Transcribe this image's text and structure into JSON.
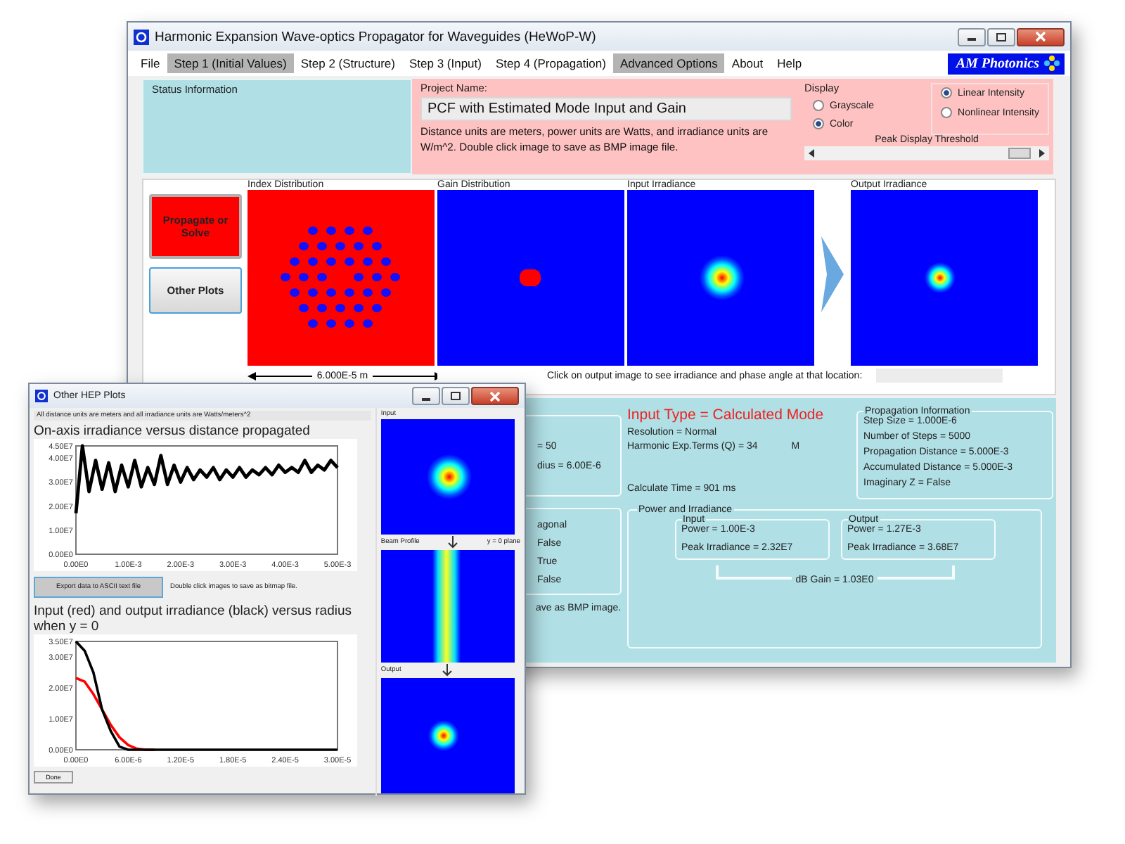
{
  "main_window": {
    "title": "Harmonic Expansion Wave-optics Propagator for Waveguides (HeWoP-W)",
    "menu": [
      {
        "label": "File",
        "highlighted": false
      },
      {
        "label": "Step 1 (Initial Values)",
        "highlighted": true
      },
      {
        "label": "Step 2 (Structure)",
        "highlighted": false
      },
      {
        "label": "Step 3 (Input)",
        "highlighted": false
      },
      {
        "label": "Step 4 (Propagation)",
        "highlighted": false
      },
      {
        "label": "Advanced Options",
        "highlighted": true
      },
      {
        "label": "About",
        "highlighted": false
      },
      {
        "label": "Help",
        "highlighted": false
      }
    ],
    "logo": "AM Photonics",
    "status_panel": {
      "title": "Status Information"
    },
    "project": {
      "label": "Project Name:",
      "value": "PCF with Estimated Mode Input and Gain",
      "note": "Distance units are meters, power units are Watts, and irradiance units are W/m^2.  Double click image to save as BMP image file."
    },
    "display": {
      "title": "Display",
      "color_modes": [
        {
          "label": "Grayscale",
          "selected": false
        },
        {
          "label": "Color",
          "selected": true
        }
      ],
      "intensity_modes": [
        {
          "label": "Linear Intensity",
          "selected": true
        },
        {
          "label": "Nonlinear Intensity",
          "selected": false
        }
      ],
      "threshold": {
        "label": "Peak Display Threshold",
        "level": 0.93
      }
    },
    "buttons": [
      {
        "label": "Propagate or Solve",
        "kind": "primary"
      },
      {
        "label": "Other Plots",
        "kind": "normal"
      }
    ],
    "images": [
      {
        "label": "Index Distribution",
        "kind": "index"
      },
      {
        "label": "Gain Distribution",
        "kind": "gain"
      },
      {
        "label": "Input Irradiance",
        "kind": "spot"
      },
      {
        "label": "Output Irradiance",
        "kind": "spot_small"
      }
    ],
    "scale": "6.000E-5 m",
    "click_hint": "Click on output image to see irradiance and phase angle at that location:",
    "structure_lines": [
      "=  50",
      "dius = 6.00E-6"
    ],
    "option_lines": [
      "agonal",
      "False",
      "True",
      "False"
    ],
    "save_hint": "ave as BMP image.",
    "input_type": "Input Type = Calculated Mode",
    "resolution": "Resolution = Normal",
    "harmonic": "Harmonic Exp.Terms (Q) =  34",
    "harmonic_unit": "M",
    "calc_time": "Calculate Time = 901 ms",
    "propagation": {
      "title": "Propagation Information",
      "lines": [
        "Step Size = 1.000E-6",
        "Number of Steps = 5000",
        "Propagation Distance = 5.000E-3",
        "Accumulated Distance = 5.000E-3",
        "Imaginary Z = False"
      ]
    },
    "power": {
      "title": "Power and Irradiance",
      "groups": [
        {
          "title": "Input",
          "lines": [
            "Power = 1.00E-3",
            "Peak Irradiance = 2.32E7"
          ]
        },
        {
          "title": "Output",
          "lines": [
            "Power = 1.27E-3",
            "Peak Irradiance = 3.68E7"
          ]
        }
      ],
      "gain": "dB Gain = 1.03E0"
    }
  },
  "plots_window": {
    "title": "Other HEP Plots",
    "note": "All distance units are meters and all irradiance units are Watts/meters^2",
    "chart1": {
      "chart_data": {
        "type": "line",
        "title": "On-axis irradiance versus distance propagated",
        "x": [
          0,
          0.000125,
          0.00025,
          0.000375,
          0.0005,
          0.000625,
          0.00075,
          0.000875,
          0.001,
          0.001125,
          0.00125,
          0.001375,
          0.0015,
          0.001625,
          0.00175,
          0.001875,
          0.002,
          0.002125,
          0.00225,
          0.002375,
          0.0025,
          0.002625,
          0.00275,
          0.002875,
          0.003,
          0.003125,
          0.00325,
          0.003375,
          0.0035,
          0.003625,
          0.00375,
          0.003875,
          0.004,
          0.004125,
          0.00425,
          0.004375,
          0.0045,
          0.004625,
          0.00475,
          0.004875,
          0.005
        ],
        "series": [
          {
            "color": "#000000",
            "values": [
              17000000.0,
              45000000.0,
              26000000.0,
              39000000.0,
              27000000.0,
              38000000.0,
              26000000.0,
              37000000.0,
              28000000.0,
              39000000.0,
              28000000.0,
              36000000.0,
              29000000.0,
              41000000.0,
              29000000.0,
              37000000.0,
              30000000.0,
              36000000.0,
              31000000.0,
              35000000.0,
              32000000.0,
              36000000.0,
              31000000.0,
              35000000.0,
              32000000.0,
              36000000.0,
              32000000.0,
              35000000.0,
              33000000.0,
              36000000.0,
              33000000.0,
              37000000.0,
              34000000.0,
              36000000.0,
              34000000.0,
              39000000.0,
              34000000.0,
              37000000.0,
              35000000.0,
              39000000.0,
              36000000.0
            ]
          }
        ],
        "xlim": [
          0,
          0.005
        ],
        "ylim": [
          0,
          45000000.0
        ],
        "xticks": [
          {
            "value": 0,
            "label": "0.00E0"
          },
          {
            "value": 0.001,
            "label": "1.00E-3"
          },
          {
            "value": 0.002,
            "label": "2.00E-3"
          },
          {
            "value": 0.003,
            "label": "3.00E-3"
          },
          {
            "value": 0.004,
            "label": "4.00E-3"
          },
          {
            "value": 0.005,
            "label": "5.00E-3"
          }
        ],
        "yticks": [
          {
            "value": 0,
            "label": "0.00E0"
          },
          {
            "value": 10000000.0,
            "label": "1.00E7"
          },
          {
            "value": 20000000.0,
            "label": "2.00E7"
          },
          {
            "value": 30000000.0,
            "label": "3.00E7"
          },
          {
            "value": 40000000.0,
            "label": "4.00E7"
          },
          {
            "value": 45000000.0,
            "label": "4.50E7"
          }
        ]
      }
    },
    "export_button": "Export data to ASCII text file",
    "bitmap_hint": "Double click images to save as bitmap file.",
    "chart2": {
      "chart_data": {
        "type": "line",
        "title": "Input (red) and output irradiance (black) versus radius when y = 0",
        "x": [
          0,
          1e-06,
          2e-06,
          3e-06,
          4e-06,
          5e-06,
          6e-06,
          7e-06,
          8e-06,
          9e-06,
          1e-05,
          3e-05
        ],
        "series": [
          {
            "color": "#ff0000",
            "values": [
              23200000.0,
              22000000.0,
              18000000.0,
              13000000.0,
              8000000.0,
              4000000.0,
              1500000.0,
              300000.0,
              0,
              0,
              null,
              null
            ]
          },
          {
            "color": "#000000",
            "values": [
              35000000.0,
              32000000.0,
              25000000.0,
              13000000.0,
              6000000.0,
              1000000.0,
              0,
              0,
              0,
              0,
              0,
              0
            ]
          }
        ],
        "xlim": [
          0,
          3e-05
        ],
        "ylim": [
          0,
          35000000.0
        ],
        "xticks": [
          {
            "value": 0,
            "label": "0.00E0"
          },
          {
            "value": 6e-06,
            "label": "6.00E-6"
          },
          {
            "value": 1.2e-05,
            "label": "1.20E-5"
          },
          {
            "value": 1.8e-05,
            "label": "1.80E-5"
          },
          {
            "value": 2.4e-05,
            "label": "2.40E-5"
          },
          {
            "value": 3e-05,
            "label": "3.00E-5"
          }
        ],
        "yticks": [
          {
            "value": 0,
            "label": "0.00E0"
          },
          {
            "value": 10000000.0,
            "label": "1.00E7"
          },
          {
            "value": 20000000.0,
            "label": "2.00E7"
          },
          {
            "value": 30000000.0,
            "label": "3.00E7"
          },
          {
            "value": 35000000.0,
            "label": "3.50E7"
          }
        ]
      }
    },
    "done_button": "Done",
    "profile_labels": {
      "input": "Input",
      "beam": "Beam Profile",
      "plane": "y = 0 plane",
      "output": "Output"
    }
  }
}
